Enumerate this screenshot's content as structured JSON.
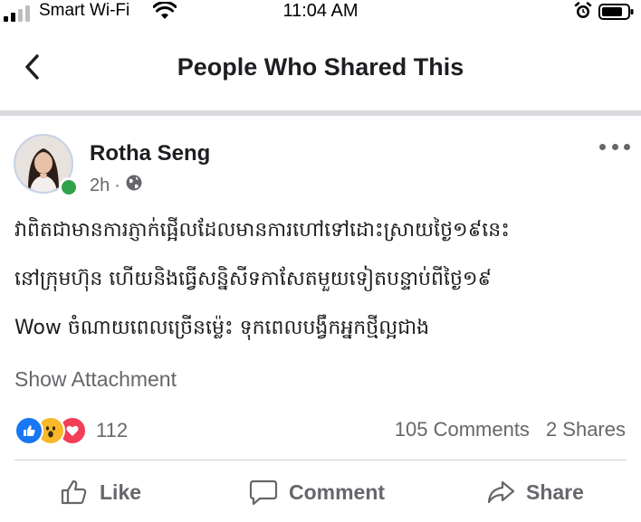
{
  "status_bar": {
    "carrier": "Smart Wi-Fi",
    "time": "11:04 AM",
    "signal_icon": "signal-bars-icon",
    "wifi_icon": "wifi-icon",
    "alarm_icon": "alarm-clock-icon",
    "battery_icon": "battery-icon"
  },
  "nav": {
    "back_icon": "chevron-left-icon",
    "title": "People Who Shared This"
  },
  "post": {
    "author": "Rotha Seng",
    "time": "2h",
    "separator": "·",
    "audience_icon": "globe-icon",
    "more_icon": "more-dots-icon",
    "text_lines": [
      "វាពិតជាមានការភ្ញាក់ផ្អើលដែលមានការហៅទៅដោះស្រាយថ្ងៃ១៩នេះ",
      "នៅក្រុមហ៊ុន ហើយនិងធ្វើសន្និសីទកាសែតមួយទៀតបន្ទាប់ពីថ្ងៃ១៩",
      "Wow ចំណាយពេលច្រើនម្ល៉េះ ទុកពេលបង្វឹកអ្នកថ្មីល្អជាង"
    ],
    "show_attachment": "Show Attachment",
    "reaction_icons": [
      "like-reaction-icon",
      "wow-reaction-icon",
      "love-reaction-icon"
    ],
    "reaction_count": "112",
    "comments_count": "105 Comments",
    "shares_count": "2 Shares",
    "actions": {
      "like": "Like",
      "comment": "Comment",
      "share": "Share"
    }
  },
  "colors": {
    "accent": "#1877f2",
    "online": "#31a24c",
    "secondary_text": "#65676b",
    "divider": "#d9dade"
  }
}
